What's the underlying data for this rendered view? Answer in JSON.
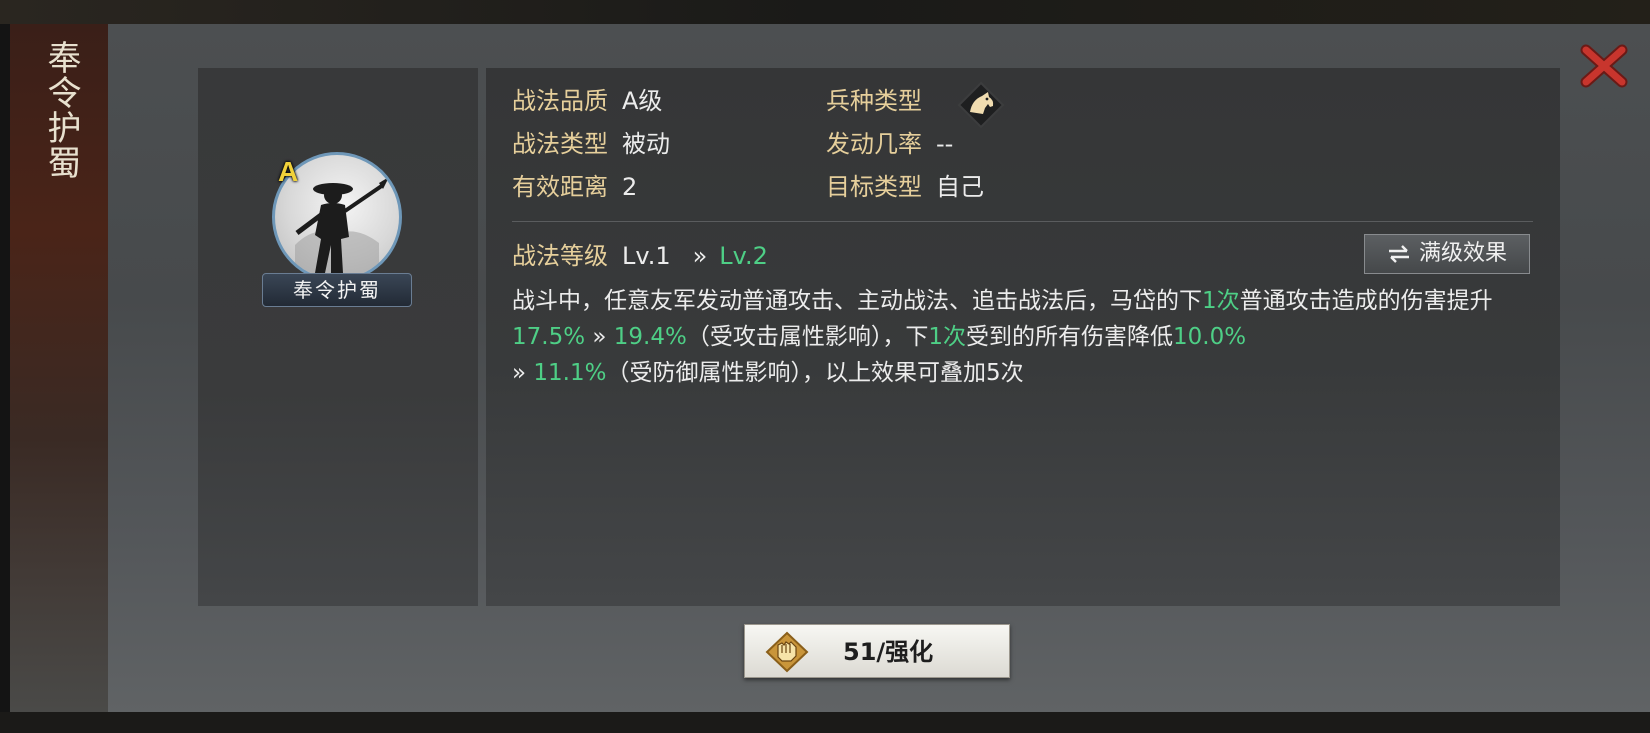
{
  "side_title": "奉令护蜀",
  "skill": {
    "name": "奉令护蜀",
    "grade": "A"
  },
  "attributes": {
    "quality_label": "战法品质",
    "quality_value": "A级",
    "type_label": "战法类型",
    "type_value": "被动",
    "range_label": "有效距离",
    "range_value": "2",
    "troop_label": "兵种类型",
    "troop_icon": "horse-icon",
    "rate_label": "发动几率",
    "rate_value": "--",
    "target_label": "目标类型",
    "target_value": "自己"
  },
  "level": {
    "label": "战法等级",
    "current": "Lv.1",
    "arrow": "»",
    "next": "Lv.2"
  },
  "max_level_button": "满级效果",
  "description": {
    "p1": "战斗中，任意友军发动普通攻击、主动战法、追击战法后，马岱的下",
    "g1": "1次",
    "p2": "普通攻击造成的伤害提升",
    "g2": "17.5%",
    "p3": " » ",
    "g3": "19.4%",
    "p4": "（受攻击属性影响），下",
    "g4": "1次",
    "p5": "受到的所有伤害降低",
    "g5": "10.0%",
    "p6": " » ",
    "g6": "11.1%",
    "p7": "（受防御属性影响），以上效果可叠加5次"
  },
  "strengthen_button": "51/强化",
  "colors": {
    "label_gold": "#e6cf9b",
    "value_green": "#4ecf86",
    "close_red": "#c8352d"
  }
}
